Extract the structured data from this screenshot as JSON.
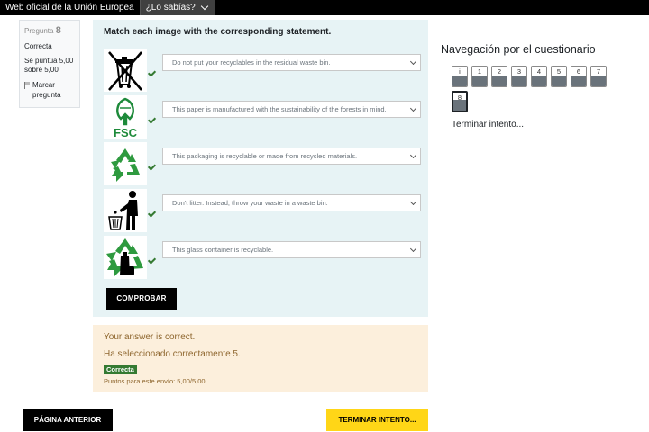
{
  "eu_bar": {
    "site_label": "Web oficial de la Unión Europea",
    "know_label": "¿Lo sabías?"
  },
  "info": {
    "question_prefix": "Pregunta",
    "question_number": "8",
    "state": "Correcta",
    "grade_line1": "Se puntúa 5,00",
    "grade_line2": "sobre 5,00",
    "flag_line1": "Marcar",
    "flag_line2": "pregunta"
  },
  "question": {
    "text": "Match each image with the corresponding statement.",
    "rows": [
      {
        "icon": "crossed-out-bin-icon",
        "selected": "Do not put your recyclables in the residual waste bin."
      },
      {
        "icon": "fsc-logo-icon",
        "selected": "This paper is manufactured with the sustainability of the forests in mind."
      },
      {
        "icon": "recycle-icon",
        "selected": "This packaging is recyclable or made from recycled materials."
      },
      {
        "icon": "tidy-man-icon",
        "selected": "Don't litter. Instead, throw your waste in a waste bin."
      },
      {
        "icon": "glass-recycle-icon",
        "selected": "This glass container is recyclable."
      }
    ],
    "check_label": "COMPROBAR"
  },
  "feedback": {
    "line1": "Your answer is correct.",
    "line2": "Ha seleccionado correctamente 5.",
    "badge": "Correcta",
    "points": "Puntos para este envío: 5,00/5,00."
  },
  "buttons": {
    "prev_label": "PÁGINA ANTERIOR",
    "finish_label": "TERMINAR INTENTO..."
  },
  "navigation": {
    "title": "Navegación por el cuestionario",
    "items": [
      "i",
      "1",
      "2",
      "3",
      "4",
      "5",
      "6",
      "7",
      "8"
    ],
    "current": "8",
    "finish_link": "Terminar intento..."
  },
  "colors": {
    "accent_yellow": "#ffd617",
    "success_green": "#357a32",
    "content_bg": "#e7f3f5",
    "feedback_bg": "#fcefdc"
  }
}
